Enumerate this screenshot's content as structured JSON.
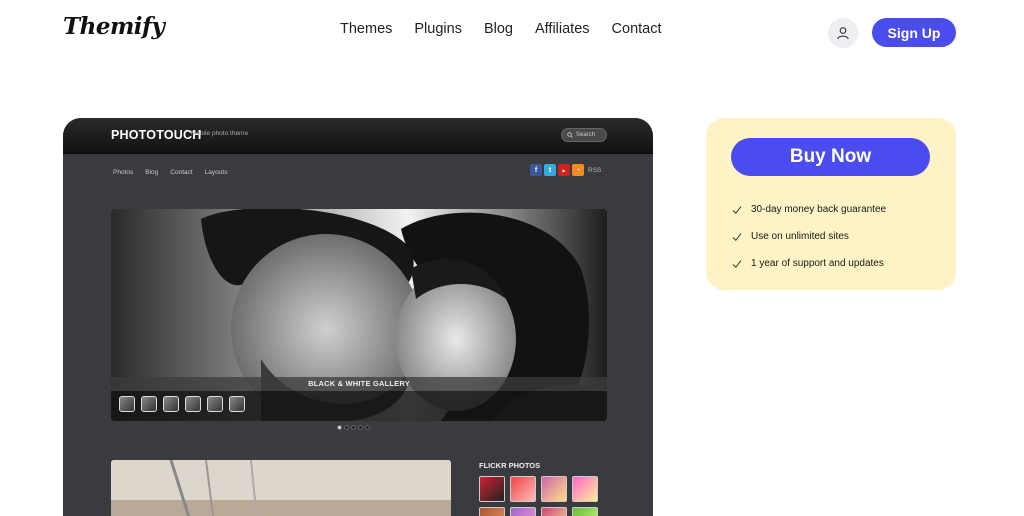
{
  "header": {
    "logo": "Themify",
    "nav": [
      "Themes",
      "Plugins",
      "Blog",
      "Affiliates",
      "Contact"
    ],
    "signup_label": "Sign Up"
  },
  "preview": {
    "brand": "PHOTOTOUCH",
    "tagline": "Mobile photo theme",
    "search_placeholder": "Search",
    "nav": [
      "Photos",
      "Blog",
      "Contact",
      "Layouts"
    ],
    "social_label": "RSS",
    "hero_caption": "BLACK & WHITE GALLERY",
    "flickr_title": "FLICKR PHOTOS"
  },
  "buybox": {
    "buy_label": "Buy Now",
    "features": [
      "30-day money back guarantee",
      "Use on unlimited sites",
      "1 year of support and updates"
    ]
  },
  "colors": {
    "accent": "#4b4cf0",
    "buybox_bg": "#fef3c4",
    "preview_bg": "#3a3b3e"
  }
}
